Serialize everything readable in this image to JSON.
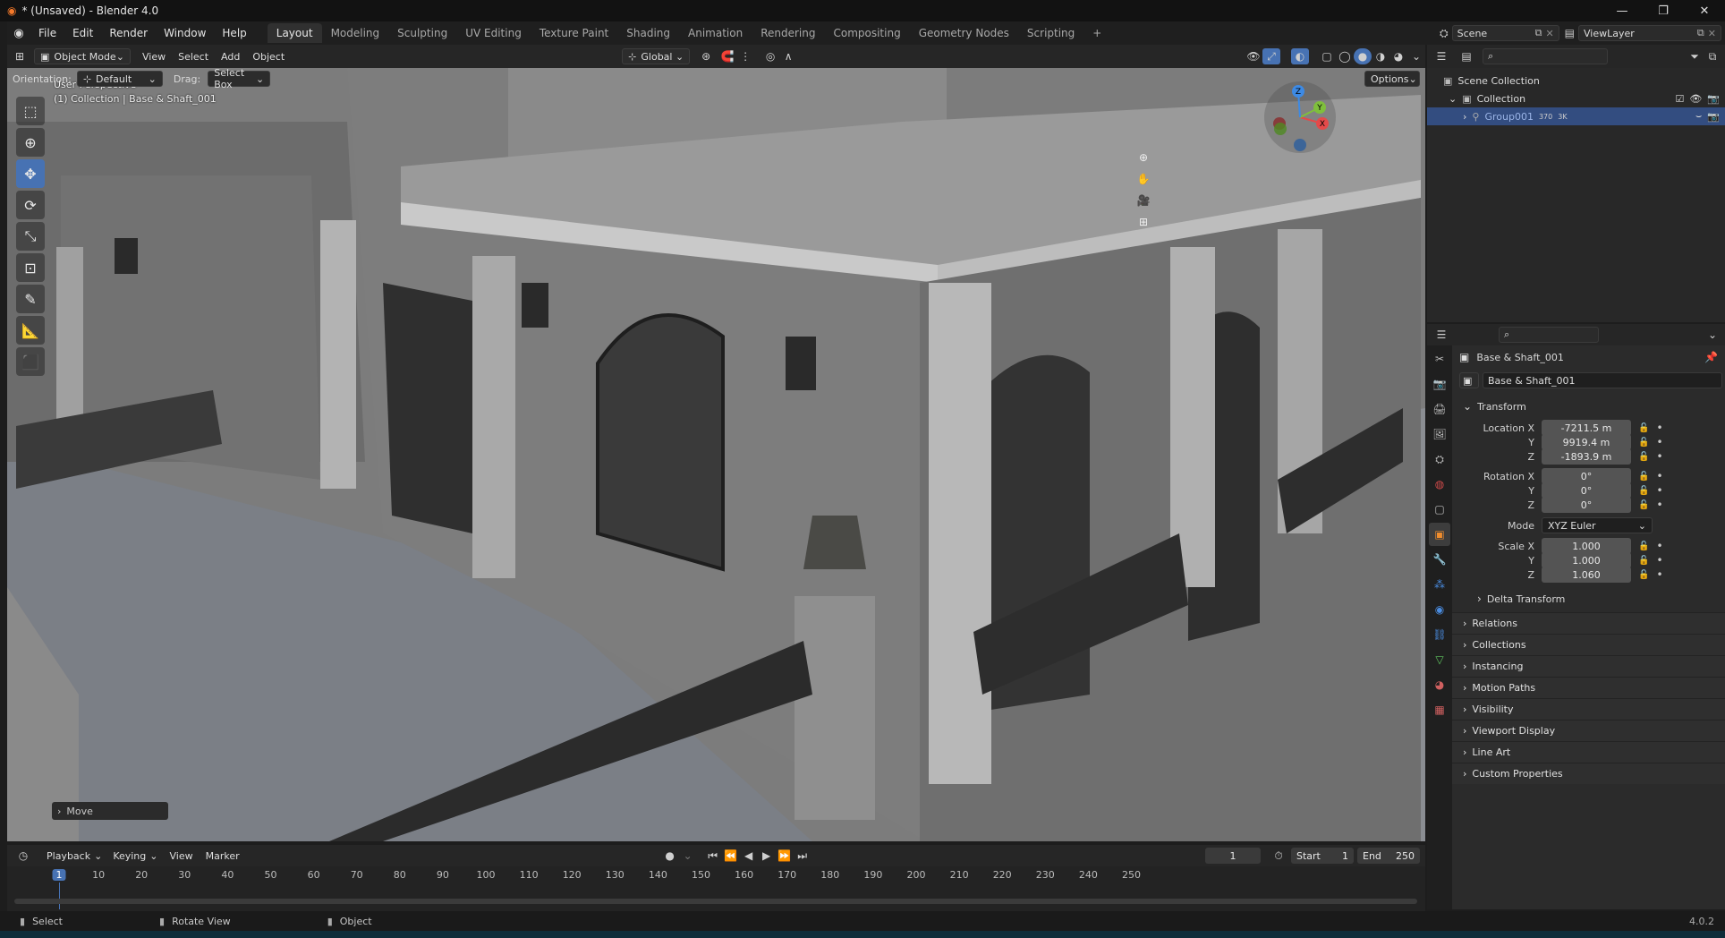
{
  "window": {
    "title": "* (Unsaved) - Blender 4.0",
    "minimize": "—",
    "maximize": "❐",
    "close": "✕"
  },
  "menu": [
    "File",
    "Edit",
    "Render",
    "Window",
    "Help"
  ],
  "workspaces": [
    "Layout",
    "Modeling",
    "Sculpting",
    "UV Editing",
    "Texture Paint",
    "Shading",
    "Animation",
    "Rendering",
    "Compositing",
    "Geometry Nodes",
    "Scripting"
  ],
  "workspace_add": "+",
  "scene": {
    "name": "Scene",
    "view_layer": "ViewLayer"
  },
  "viewport_header": {
    "mode": "Object Mode",
    "menus": [
      "View",
      "Select",
      "Add",
      "Object"
    ],
    "transform_orientation": "Global"
  },
  "tool_settings": {
    "orientation_label": "Orientation:",
    "orientation_value": "Default",
    "drag_label": "Drag:",
    "drag_value": "Select Box",
    "options": "Options"
  },
  "viewport_info": {
    "line1": "User Perspective",
    "line2": "(1) Collection | Base & Shaft_001"
  },
  "gizmo": {
    "x": "X",
    "y": "Y",
    "z": "Z"
  },
  "operator_panel": {
    "label": "Move"
  },
  "outliner": {
    "scene_collection": "Scene Collection",
    "collection": "Collection",
    "object": "Group001",
    "object_badge_a": "370",
    "object_badge_b": "3K"
  },
  "properties": {
    "object_name": "Base & Shaft_001",
    "datablock_name": "Base & Shaft_001",
    "transform_title": "Transform",
    "location_label": "Location X",
    "location": {
      "x": "-7211.5 m",
      "y": "9919.4 m",
      "z": "-1893.9 m"
    },
    "rotation_label": "Rotation X",
    "rotation": {
      "x": "0°",
      "y": "0°",
      "z": "0°"
    },
    "mode_label": "Mode",
    "mode_value": "XYZ Euler",
    "scale_label": "Scale X",
    "scale": {
      "x": "1.000",
      "y": "1.000",
      "z": "1.060"
    },
    "axis_y": "Y",
    "axis_z": "Z",
    "delta_transform": "Delta Transform",
    "sections": [
      "Relations",
      "Collections",
      "Instancing",
      "Motion Paths",
      "Visibility",
      "Viewport Display",
      "Line Art",
      "Custom Properties"
    ]
  },
  "timeline": {
    "menus": [
      "Playback",
      "Keying",
      "View",
      "Marker"
    ],
    "current_frame": "1",
    "start_label": "Start",
    "start_value": "1",
    "end_label": "End",
    "end_value": "250",
    "ruler": [
      "1",
      "10",
      "20",
      "30",
      "40",
      "50",
      "60",
      "70",
      "80",
      "90",
      "100",
      "110",
      "120",
      "130",
      "140",
      "150",
      "160",
      "170",
      "180",
      "190",
      "200",
      "210",
      "220",
      "230",
      "240",
      "250"
    ]
  },
  "status_bar": {
    "select": "Select",
    "rotate": "Rotate View",
    "object": "Object",
    "version": "4.0.2"
  },
  "colors": {
    "accent": "#4772b3",
    "active_frame": "#4772b3",
    "axis_x": "#e44a4a",
    "axis_y": "#7fbf3c",
    "axis_z": "#3d8ae4"
  }
}
